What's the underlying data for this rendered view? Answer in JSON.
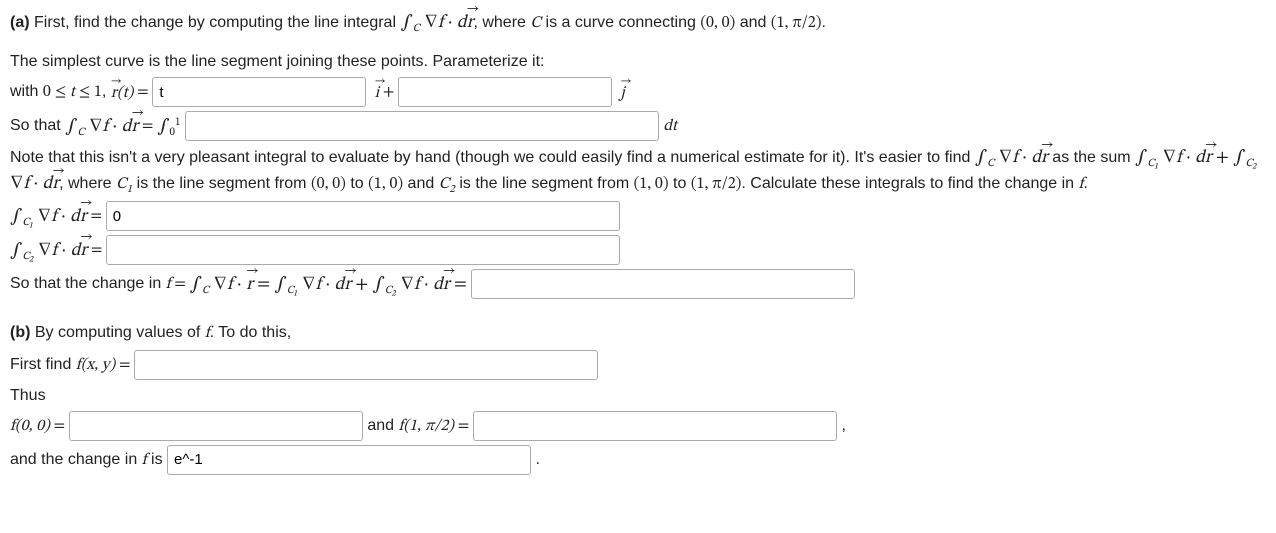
{
  "partA": {
    "label": "(a)",
    "intro1": " First, find the change by computing the line integral ",
    "intro2": ", where ",
    "intro3": " is a curve connecting ",
    "point1": "(0, 0)",
    "and": " and ",
    "point2": "(1, π/2)",
    "period": ".",
    "simplest": "The simplest curve is the line segment joining these points. Parameterize it:",
    "with": "with ",
    "range": "0 ≤ t ≤ 1",
    "comma": ", ",
    "r_eq": " = ",
    "input_i_value": "t",
    "plus": " + ",
    "input_j_value": "",
    "sothat1": "So that ",
    "int_eq": " = ",
    "input_so_value": "",
    "dt": " dt",
    "note1": "Note that this isn't a very pleasant integral to evaluate by hand (though we could easily find a numerical estimate for it). It's easier to find ",
    "note2": " as the sum ",
    "note3": ", where ",
    "note4": " is the line segment from ",
    "note5": " to ",
    "note6": " and ",
    "note7": " is the line segment from ",
    "note8": " to ",
    "note9": ". Calculate these integrals to find the change in ",
    "note_p00": "(0, 0)",
    "note_p10": "(1, 0)",
    "note_p10b": "(1, 0)",
    "note_p1p": "(1, π/2)",
    "f_period": ".",
    "c1_eq": " = ",
    "input_c1_value": "0",
    "c2_eq": " = ",
    "input_c2_value": "",
    "sothat2": "So that the change in ",
    "change_eq": " = ",
    "input_change_value": ""
  },
  "partB": {
    "label": "(b)",
    "intro": " By computing values of ",
    "intro2": ". To do this,",
    "first": "First find ",
    "f_xy": "f(x, y)",
    "eq": " = ",
    "input_fxy_value": "",
    "thus": "Thus",
    "f00": "f(0, 0)",
    "input_f00_value": "",
    "and": " and ",
    "f1p": "f(1, π/2)",
    "input_f1p_value": "",
    "comma": " ,",
    "changeline": "and the change in ",
    "is": " is ",
    "input_change_value": "e^-1",
    "period": " ."
  },
  "math": {
    "int_C_grad_f_dr": "∫C ∇f · dr⃗",
    "C": "C",
    "r_t": "r⃗(t)",
    "i": "i⃗",
    "j": "j⃗",
    "int01": "∫01",
    "int_C1": "∫C₁ ∇f · dr⃗",
    "int_C2": "∫C₂ ∇f · dr⃗",
    "C1": "C₁",
    "C2": "C₂",
    "f": "f",
    "nabla_f_r": "∫C ∇f · r⃗",
    "sum": "∫C₁ ∇f · dr⃗ + ∫C₂ ∇f · dr⃗"
  }
}
